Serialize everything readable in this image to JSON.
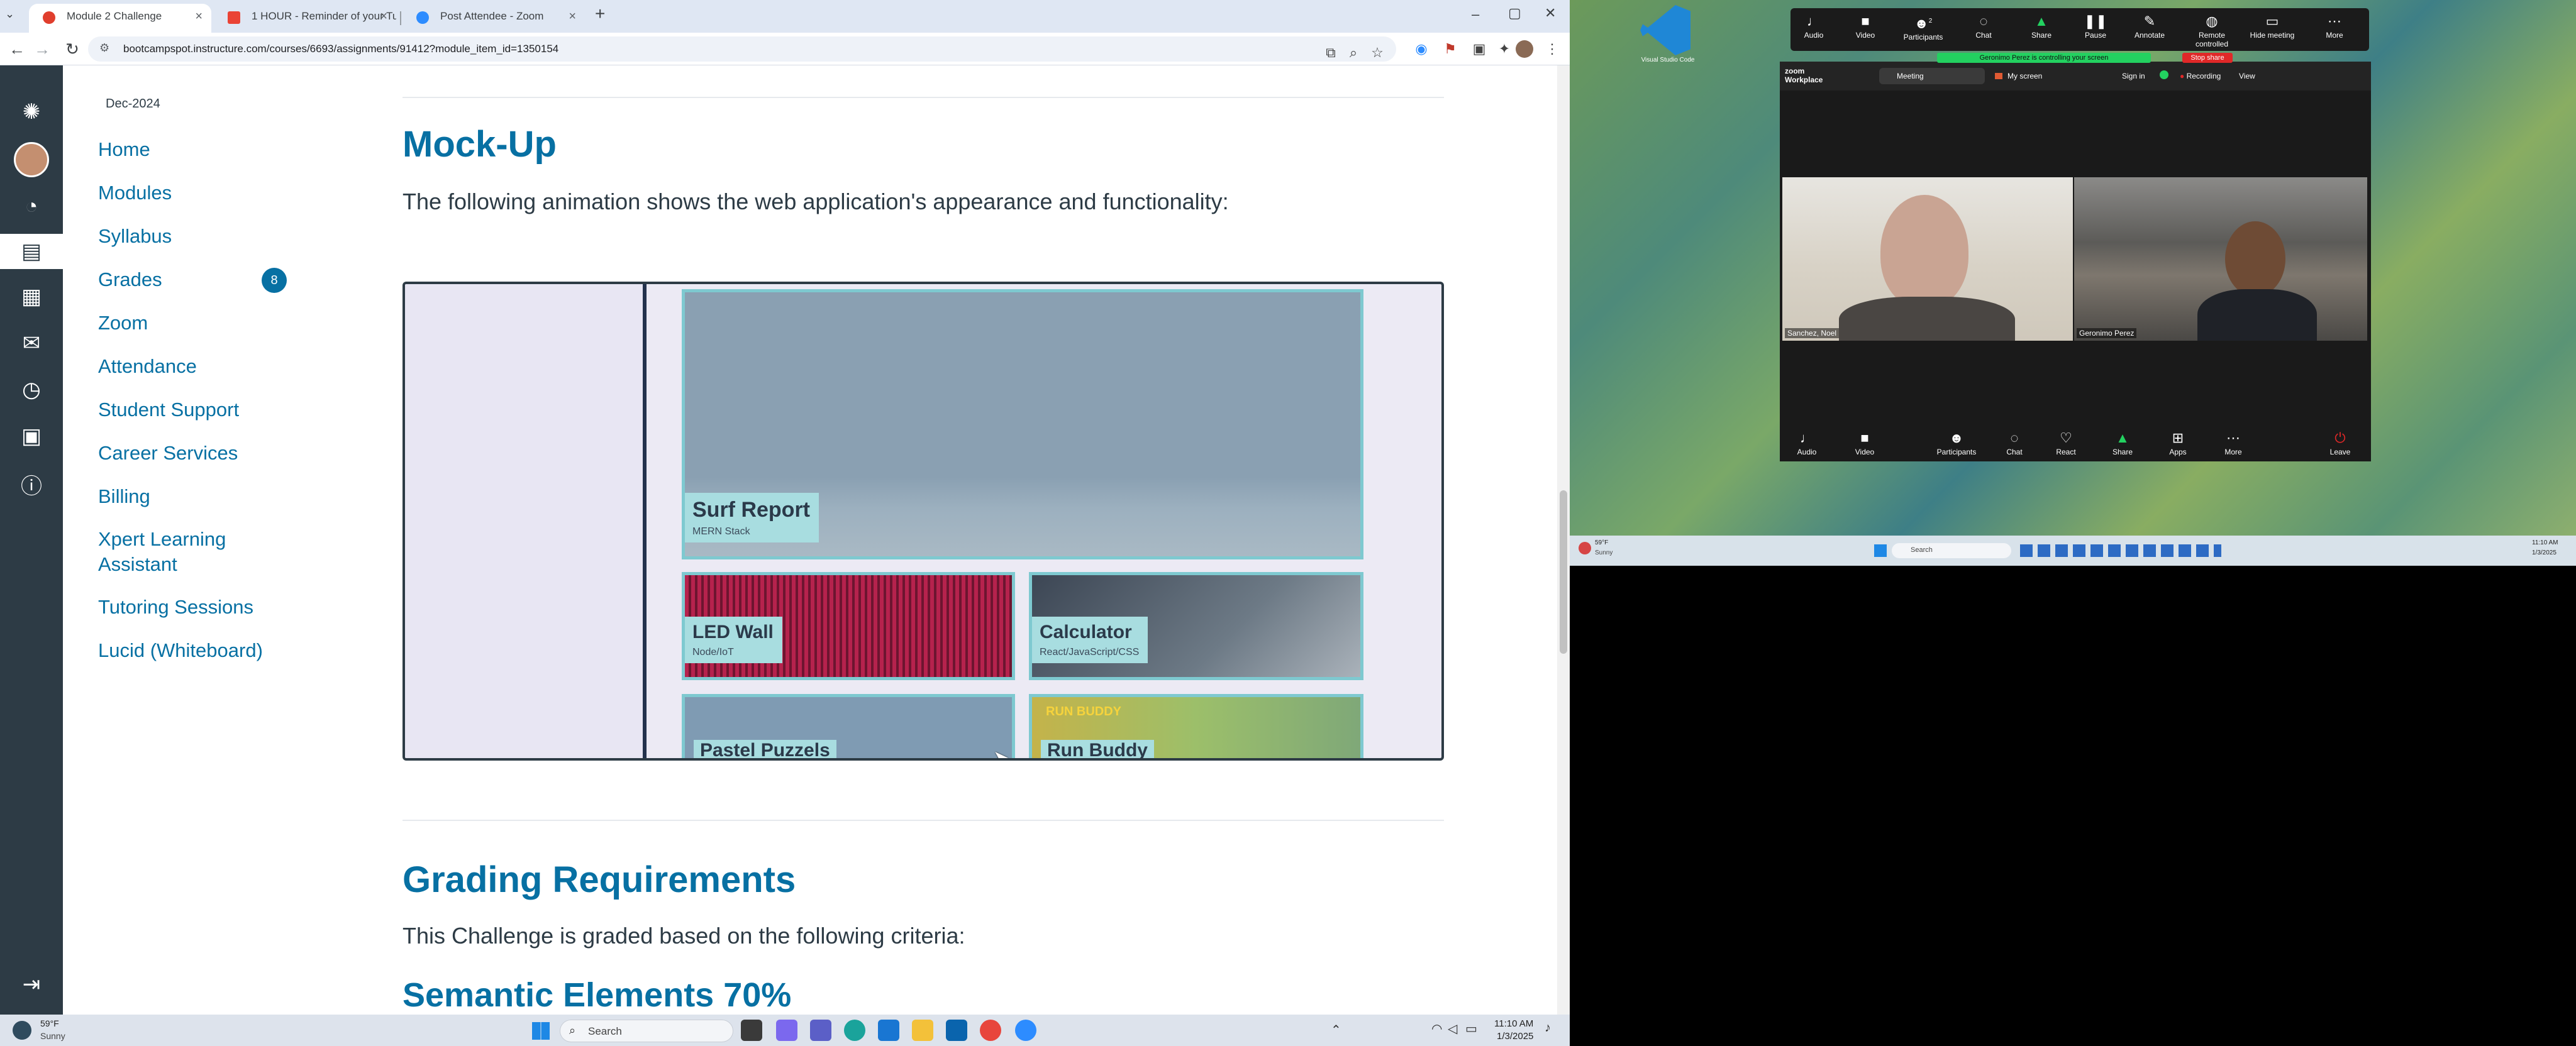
{
  "browser": {
    "tabs": [
      {
        "title": "Module 2 Challenge",
        "active": true
      },
      {
        "title": "1 HOUR - Reminder of your Tu",
        "active": false
      },
      {
        "title": "Post Attendee - Zoom",
        "active": false
      }
    ],
    "new_tab": "+",
    "url": "bootcampspot.instructure.com/courses/6693/assignments/91412?module_item_id=1350154",
    "window_controls": {
      "minimize": "–",
      "maximize": "▢",
      "close": "✕"
    }
  },
  "canvas_nav": {
    "collapse_icon": "⇥"
  },
  "course_nav": {
    "term": "Dec-2024",
    "items": [
      "Home",
      "Modules",
      "Syllabus",
      "Grades",
      "Zoom",
      "Attendance",
      "Student Support",
      "Career Services",
      "Billing",
      "Xpert Learning Assistant",
      "Tutoring Sessions",
      "Lucid (Whiteboard)"
    ],
    "grades_badge": "8"
  },
  "content": {
    "mockup_heading": "Mock-Up",
    "mockup_text": "The following animation shows the web application's appearance and functionality:",
    "grading_heading": "Grading Requirements",
    "grading_text": "This Challenge is graded based on the following criteria:",
    "semantic_heading": "Semantic Elements 70%"
  },
  "mockup": {
    "cards": [
      {
        "title": "Surf Report",
        "subtitle": "MERN Stack"
      },
      {
        "title": "LED Wall",
        "subtitle": "Node/IoT"
      },
      {
        "title": "Calculator",
        "subtitle": "React/JavaScript/CSS"
      },
      {
        "title": "Pastel Puzzels",
        "subtitle": ""
      },
      {
        "title": "Run Buddy",
        "subtitle": ""
      }
    ],
    "run_buddy_logo": "RUN BUDDY"
  },
  "taskbar_left": {
    "weather_temp": "59°F",
    "weather_desc": "Sunny",
    "search": "Search",
    "time": "11:10 AM",
    "date": "1/3/2025"
  },
  "zoom": {
    "toolbar": [
      "Audio",
      "Video",
      "Participants",
      "Chat",
      "Share",
      "Pause",
      "Annotate",
      "Remote controlled",
      "Hide meeting",
      "More"
    ],
    "participants_count": "2",
    "control_banner": "Geronimo Perez is controlling your screen",
    "stop_share": "Stop share",
    "window": {
      "brand": "zoom Workplace",
      "tab_meeting": "Meeting",
      "tab_myscreen": "My screen",
      "sign_in": "Sign in",
      "recording": "Recording",
      "view": "View"
    },
    "participants": [
      {
        "name": "Sanchez, Noel"
      },
      {
        "name": "Geronimo Perez"
      }
    ],
    "bottom_bar": [
      "Audio",
      "Video",
      "Participants",
      "Chat",
      "React",
      "Share",
      "Apps",
      "More",
      "Leave"
    ]
  },
  "taskbar_right": {
    "weather_temp": "59°F",
    "weather_desc": "Sunny",
    "search": "Search",
    "time": "11:10 AM",
    "date": "1/3/2025"
  },
  "vscode_label": "Visual Studio Code",
  "colors": {
    "canvas_blue": "#0770a3",
    "canvas_nav": "#2d3b45",
    "zoom_green": "#23d160",
    "stop_red": "#e02828"
  }
}
